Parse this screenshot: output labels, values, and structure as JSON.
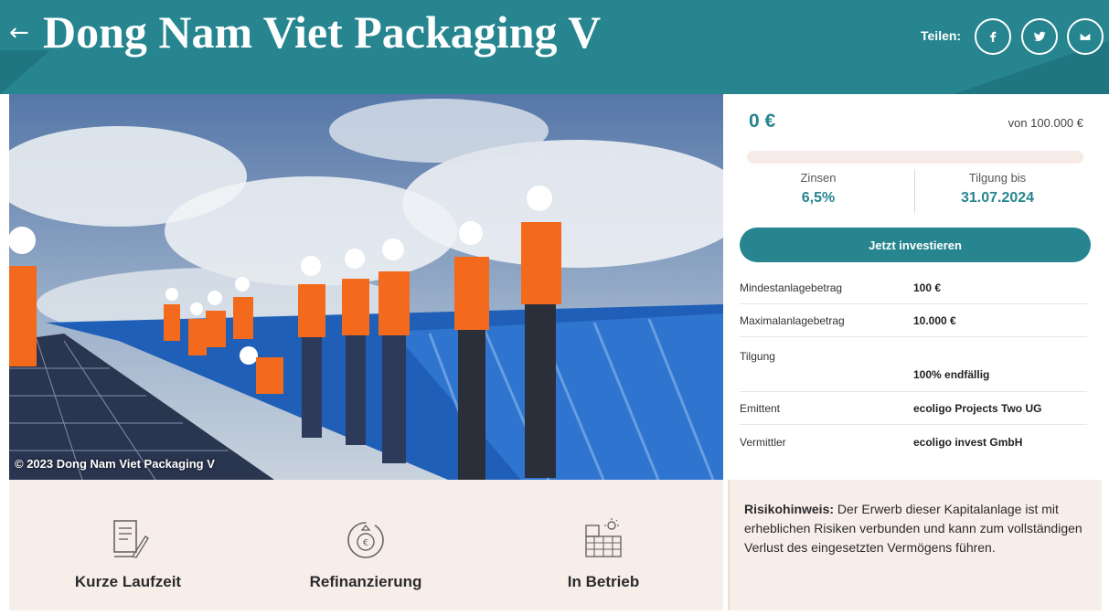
{
  "header": {
    "back_label": "←",
    "title": "Dong Nam Viet Packaging V",
    "share_label": "Teilen:",
    "share_buttons": [
      "facebook-icon",
      "twitter-icon",
      "mail-icon"
    ]
  },
  "hero": {
    "caption": "© 2023 Dong Nam Viet Packaging V"
  },
  "funding": {
    "amount": "0 €",
    "target": "von 100.000 €",
    "progress_percent": 0
  },
  "stats": {
    "interest_label": "Zinsen",
    "interest_value": "6,5%",
    "repayment_label": "Tilgung bis",
    "repayment_value": "31.07.2024"
  },
  "invest_button_label": "Jetzt investieren",
  "details": {
    "rows": [
      {
        "key": "Mindestanlagebetrag",
        "value": "100 €"
      },
      {
        "key": "Maximalanlagebetrag",
        "value": "10.000 €"
      },
      {
        "key": "Tilgung",
        "value": "100% endfällig"
      },
      {
        "key": "Emittent",
        "value": "ecoligo Projects Two UG"
      },
      {
        "key": "Vermittler",
        "value": "ecoligo invest GmbH"
      }
    ]
  },
  "features": [
    {
      "label": "Kurze Laufzeit",
      "icon": "document-quill-icon"
    },
    {
      "label": "Refinanzierung",
      "icon": "refinance-coin-icon"
    },
    {
      "label": "In Betrieb",
      "icon": "solar-building-icon"
    }
  ],
  "risk": {
    "title": "Risikohinweis:",
    "text": " Der Erwerb dieser Kapitalanlage ist mit erheblichen Risiken verbunden und kann zum vollständigen Verlust des eingesetzten Vermögens führen."
  },
  "colors": {
    "brand": "#26858f",
    "light_bg": "#f7eeea"
  }
}
